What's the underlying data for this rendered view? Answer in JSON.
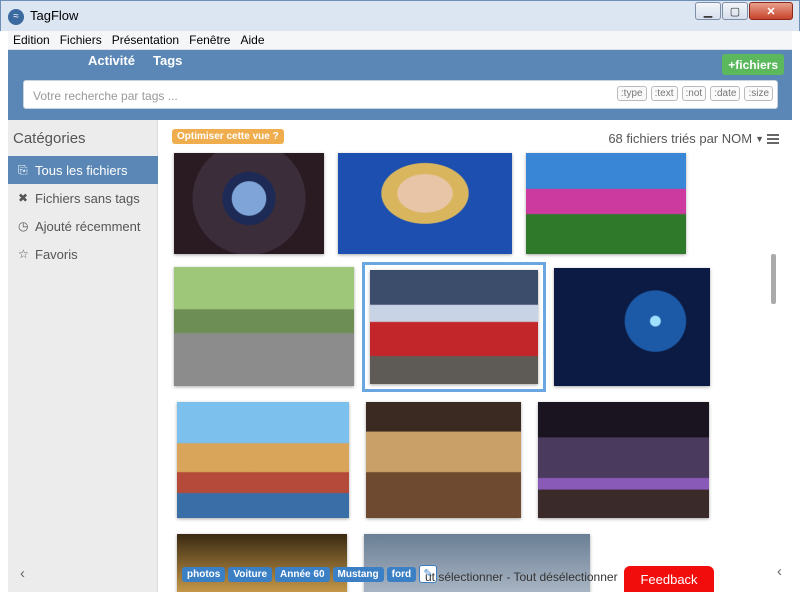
{
  "window": {
    "title": "TagFlow",
    "controls": {
      "minimize": "▁",
      "maximize": "▢",
      "close": "✕"
    }
  },
  "menu": [
    "Edition",
    "Fichiers",
    "Présentation",
    "Fenêtre",
    "Aide"
  ],
  "header": {
    "tabs": [
      "Activité",
      "Tags"
    ],
    "add_button": "+fichiers",
    "search_placeholder": "Votre recherche par tags ...",
    "filters": [
      ":type",
      ":text",
      ":not",
      ":date",
      ":size"
    ]
  },
  "sidebar": {
    "title": "Catégories",
    "items": [
      {
        "label": "Tous les fichiers",
        "icon": "files-icon",
        "glyph": "⎘",
        "active": true
      },
      {
        "label": "Fichiers sans tags",
        "icon": "x-icon",
        "glyph": "✖",
        "active": false
      },
      {
        "label": "Ajouté récemment",
        "icon": "clock-icon",
        "glyph": "◷",
        "active": false
      },
      {
        "label": "Favoris",
        "icon": "star-icon",
        "glyph": "☆",
        "active": false
      }
    ]
  },
  "content": {
    "optimize_label": "Optimiser cette vue ?",
    "sort_label": "68 fichiers triés par NOM",
    "selection_text": "ut sélectionner - Tout désélectionner"
  },
  "tags": [
    "photos",
    "Voiture",
    "Année 60",
    "Mustang",
    "ford"
  ],
  "feedback_label": "Feedback",
  "colors": {
    "header": "#5a87b5",
    "add_button": "#5cb85c",
    "optimize": "#f0ad4e",
    "tag": "#3b7fc4",
    "feedback": "#f20d0d",
    "selection": "#6aa7e0"
  }
}
